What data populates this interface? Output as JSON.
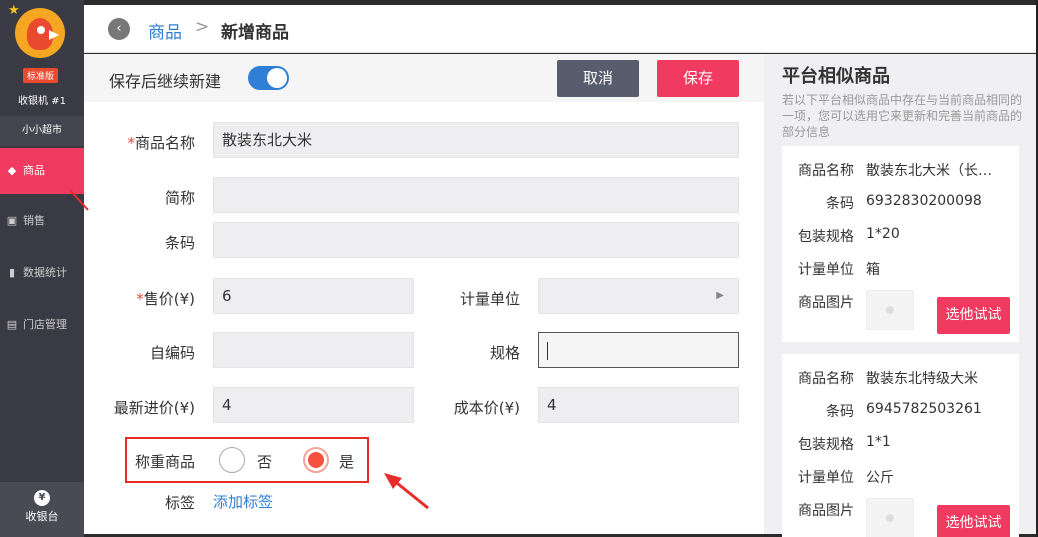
{
  "sidebar": {
    "edition": "标准版",
    "device": "收银机 #1",
    "store_name": "小小超市",
    "items": [
      {
        "label": "商品"
      },
      {
        "label": "销售"
      },
      {
        "label": "数据统计"
      },
      {
        "label": "门店管理"
      }
    ],
    "cashier": {
      "symbol": "¥",
      "label": "收银台"
    }
  },
  "breadcrumb": {
    "link": "商品",
    "separator": ">",
    "current": "新增商品"
  },
  "actionbar": {
    "continue_label": "保存后继续新建",
    "continue_toggle_on": true,
    "cancel_label": "取消",
    "save_label": "保存"
  },
  "form": {
    "required_mark": "*",
    "name_label": "商品名称",
    "name_value": "散装东北大米",
    "short_name_label": "简称",
    "barcode_label": "条码",
    "price_label": "售价(¥)",
    "price_value": "6",
    "unit_label": "计量单位",
    "self_code_label": "自编码",
    "spec_label": "规格",
    "latest_purchase_label": "最新进价(¥)",
    "latest_purchase_value": "4",
    "cost_label": "成本价(¥)",
    "cost_value": "4",
    "weigh_label": "称重商品",
    "weigh_no": "否",
    "weigh_yes": "是",
    "weigh_selected": "是",
    "tag_label": "标签",
    "add_tag": "添加标签"
  },
  "similar": {
    "title": "平台相似商品",
    "description": "若以下平台相似商品中存在与当前商品相同的一项，您可以选用它来更新和完善当前商品的部分信息",
    "field_labels": {
      "name": "商品名称",
      "barcode": "条码",
      "pack": "包装规格",
      "unit": "计量单位",
      "image": "商品图片"
    },
    "button_label": "选他试试",
    "items": [
      {
        "name": "散装东北大米（长…",
        "barcode": "6932830200098",
        "pack": "1*20",
        "unit": "箱"
      },
      {
        "name": "散装东北特级大米",
        "barcode": "6945782503261",
        "pack": "1*1",
        "unit": "公斤"
      }
    ]
  },
  "colors": {
    "accent": "#f03a5f",
    "link": "#2f7fd6",
    "sidebar": "#3a3a44",
    "highlight_box": "#e82c2c"
  }
}
